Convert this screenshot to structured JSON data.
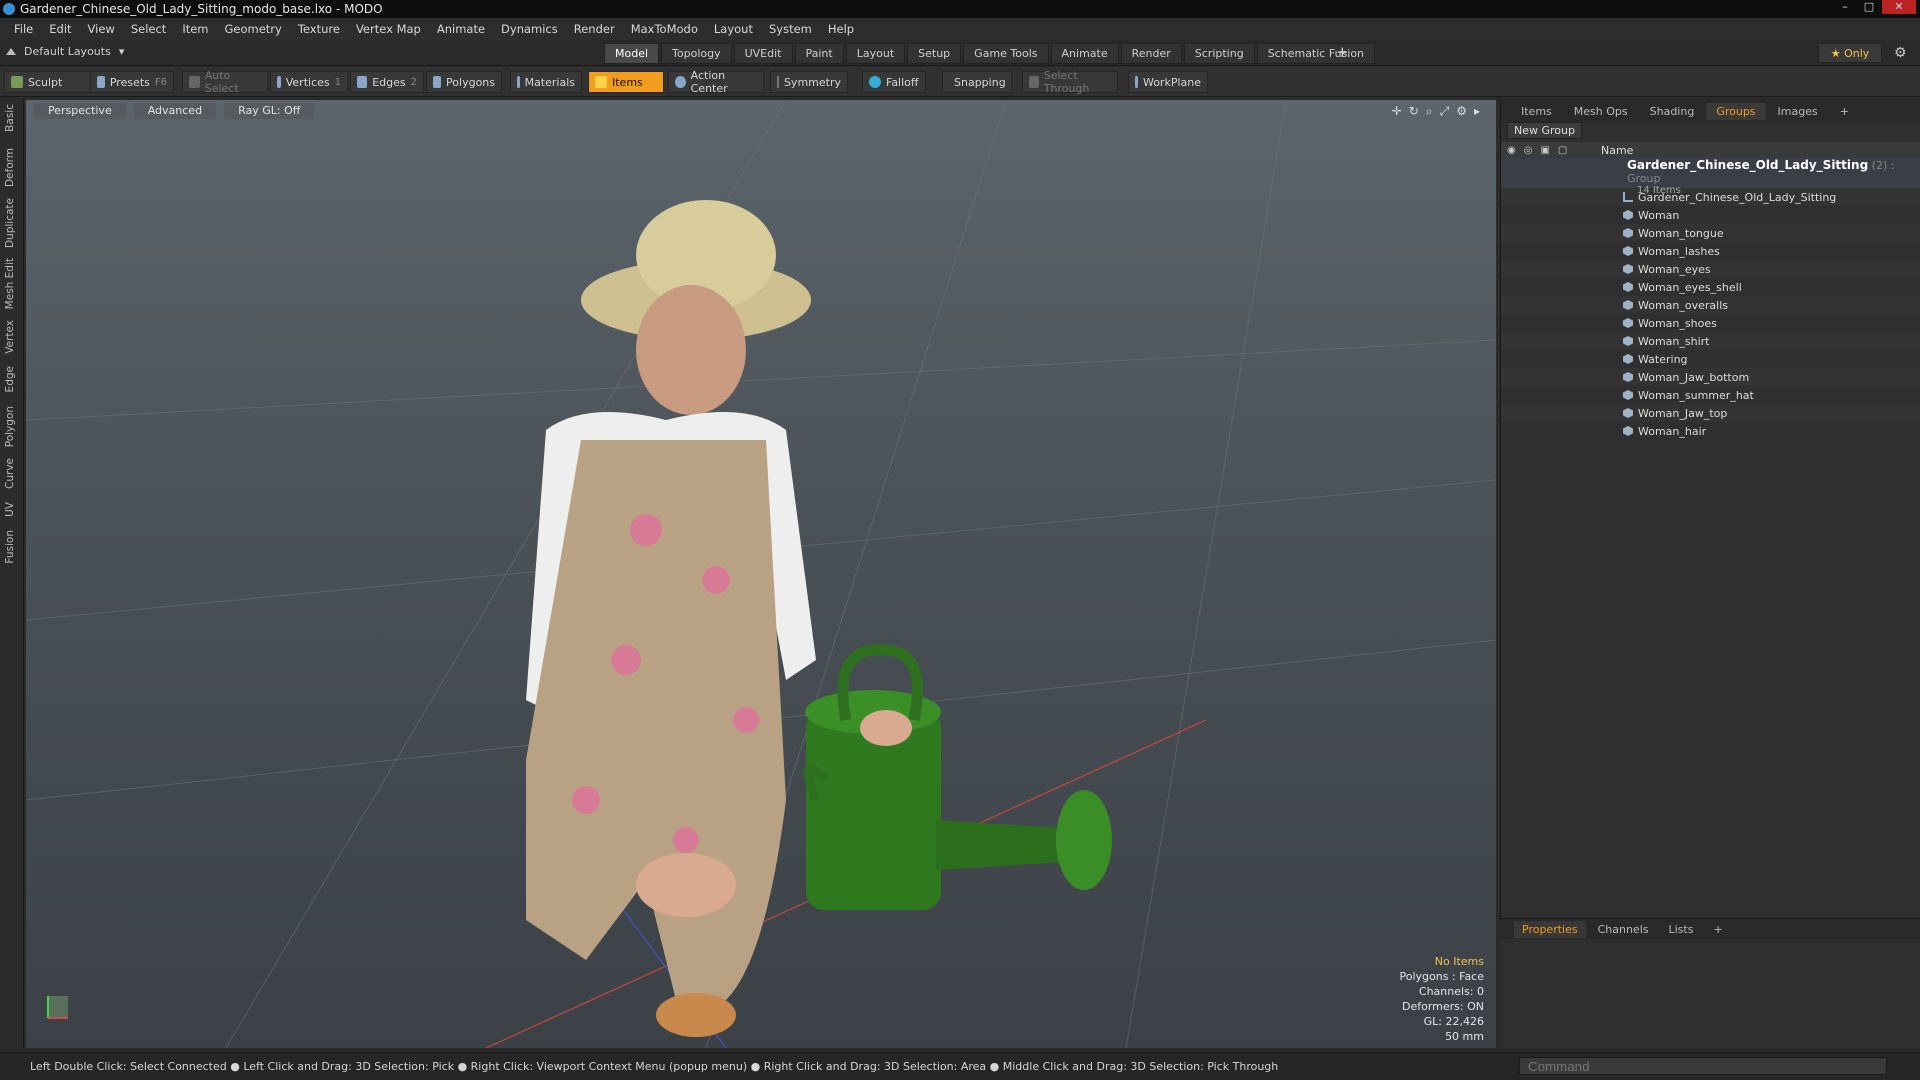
{
  "window": {
    "title": "Gardener_Chinese_Old_Lady_Sitting_modo_base.lxo - MODO"
  },
  "menu": [
    "File",
    "Edit",
    "View",
    "Select",
    "Item",
    "Geometry",
    "Texture",
    "Vertex Map",
    "Animate",
    "Dynamics",
    "Render",
    "MaxToModo",
    "Layout",
    "System",
    "Help"
  ],
  "layouts": {
    "label": "Default Layouts"
  },
  "mode_tabs": [
    {
      "label": "Model",
      "active": true
    },
    {
      "label": "Topology"
    },
    {
      "label": "UVEdit"
    },
    {
      "label": "Paint"
    },
    {
      "label": "Layout"
    },
    {
      "label": "Setup"
    },
    {
      "label": "Game Tools"
    },
    {
      "label": "Animate"
    },
    {
      "label": "Render"
    },
    {
      "label": "Scripting"
    },
    {
      "label": "Schematic Fusion"
    }
  ],
  "plus": "+",
  "only_label": "★ Only",
  "toolbar": {
    "sculpt": "Sculpt",
    "presets": "Presets",
    "presets_key": "F6",
    "auto_select": "Auto Select",
    "vertices": "Vertices",
    "vertices_key": "1",
    "edges": "Edges",
    "edges_key": "2",
    "polygons": "Polygons",
    "materials": "Materials",
    "items": "Items",
    "action_center": "Action Center",
    "symmetry": "Symmetry",
    "falloff": "Falloff",
    "snapping": "Snapping",
    "select_through": "Select Through",
    "workplane": "WorkPlane"
  },
  "side_tabs": [
    "Basic",
    "Deform",
    "Duplicate",
    "Mesh Edit",
    "Vertex",
    "Edge",
    "Polygon",
    "Curve",
    "UV",
    "Fusion"
  ],
  "viewport": {
    "view": "Perspective",
    "shading": "Advanced",
    "raygl": "Ray GL: Off",
    "stats": {
      "selection": "No Items",
      "polygons": "Polygons : Face",
      "channels": "Channels: 0",
      "deformers": "Deformers: ON",
      "gl": "GL: 22,426",
      "lens": "50 mm"
    }
  },
  "panel": {
    "tabs": [
      "Items",
      "Mesh Ops",
      "Shading",
      "Groups",
      "Images"
    ],
    "active_tab": "Groups",
    "new_group": "New Group",
    "name_header": "Name",
    "group": {
      "name": "Gardener_Chinese_Old_Lady_Sitting",
      "meta": "(2) : Group",
      "count": "14 Items"
    },
    "items": [
      {
        "label": "Gardener_Chinese_Old_Lady_Sitting",
        "kind": "locator"
      },
      {
        "label": "Woman",
        "kind": "mesh"
      },
      {
        "label": "Woman_tongue",
        "kind": "mesh"
      },
      {
        "label": "Woman_lashes",
        "kind": "mesh"
      },
      {
        "label": "Woman_eyes",
        "kind": "mesh"
      },
      {
        "label": "Woman_eyes_shell",
        "kind": "mesh"
      },
      {
        "label": "Woman_overalls",
        "kind": "mesh"
      },
      {
        "label": "Woman_shoes",
        "kind": "mesh"
      },
      {
        "label": "Woman_shirt",
        "kind": "mesh"
      },
      {
        "label": "Watering",
        "kind": "mesh"
      },
      {
        "label": "Woman_Jaw_bottom",
        "kind": "mesh"
      },
      {
        "label": "Woman_summer_hat",
        "kind": "mesh"
      },
      {
        "label": "Woman_Jaw_top",
        "kind": "mesh"
      },
      {
        "label": "Woman_hair",
        "kind": "mesh"
      }
    ]
  },
  "properties": {
    "tabs": [
      "Properties",
      "Channels",
      "Lists"
    ],
    "active": "Properties",
    "plus": "+"
  },
  "status": {
    "hint": "Left Double Click: Select Connected ● Left Click and Drag: 3D Selection: Pick ● Right Click: Viewport Context Menu (popup menu) ● Right Click and Drag: 3D Selection: Area ● Middle Click and Drag: 3D Selection: Pick Through",
    "command_placeholder": "Command"
  },
  "colors": {
    "accent": "#f29c1d",
    "highlight": "#f2c24b"
  }
}
